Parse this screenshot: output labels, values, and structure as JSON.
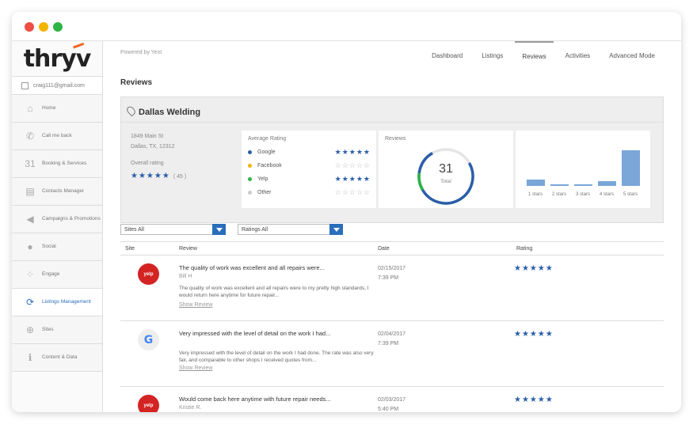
{
  "window": {
    "colors": {
      "close": "#ee4f44",
      "minimize": "#f4b400",
      "maximize": "#2fb446"
    }
  },
  "sidebar": {
    "logo": "thryv",
    "user_email": "craig111@gmail.com",
    "items": [
      {
        "label": "Home",
        "icon": "home-icon",
        "glyph": "⌂"
      },
      {
        "label": "Call me back",
        "icon": "phone-icon",
        "glyph": "✆"
      },
      {
        "label": "Booking & Services",
        "icon": "calendar-icon",
        "glyph": "31"
      },
      {
        "label": "Contacts Manager",
        "icon": "contact-card-icon",
        "glyph": "▤"
      },
      {
        "label": "Campaigns & Promotions",
        "icon": "megaphone-icon",
        "glyph": "◀"
      },
      {
        "label": "Social",
        "icon": "people-icon",
        "glyph": "●"
      },
      {
        "label": "Engage",
        "icon": "network-icon",
        "glyph": "⁘"
      },
      {
        "label": "Listings Management",
        "icon": "listings-icon",
        "glyph": "⟳"
      },
      {
        "label": "Sites",
        "icon": "globe-icon",
        "glyph": "⊕"
      },
      {
        "label": "Content & Data",
        "icon": "info-icon",
        "glyph": "ℹ"
      }
    ],
    "active_index": 7
  },
  "header": {
    "powered_by": "Powered by Yext",
    "tabs": [
      "Dashboard",
      "Listings",
      "Reviews",
      "Activities",
      "Advanced Mode"
    ],
    "active_tab": "Reviews"
  },
  "page_title": "Reviews",
  "business": {
    "name": "Dallas Welding",
    "address_line1": "1849 Main St",
    "address_line2": "Dallas, TX, 12312",
    "overall_rating_label": "Overall rating",
    "overall_stars": "★★★★★",
    "overall_count": "( 45 )"
  },
  "average_rating": {
    "title": "Average Rating",
    "sources": [
      {
        "name": "Google",
        "color": "#2a5ea8",
        "stars": "★★★★★",
        "empty": false
      },
      {
        "name": "Facebook",
        "color": "#f4b400",
        "stars": "☆☆☆☆☆",
        "empty": true
      },
      {
        "name": "Yelp",
        "color": "#2fb446",
        "stars": "★★★★★",
        "empty": false
      },
      {
        "name": "Other",
        "color": "#cccccc",
        "stars": "☆☆☆☆☆",
        "empty": true
      }
    ]
  },
  "reviews_summary": {
    "title": "Reviews",
    "total": "31",
    "total_label": "Total"
  },
  "distribution": {
    "labels": [
      "1 stars",
      "2 stars",
      "3 stars",
      "4 stars",
      "5 stars"
    ],
    "values": [
      4,
      1,
      1,
      3,
      22
    ]
  },
  "filters": {
    "sites": "Sites All",
    "ratings": "Ratings All"
  },
  "table": {
    "headers": {
      "site": "Site",
      "review": "Review",
      "date": "Date",
      "rating": "Rating"
    },
    "rows": [
      {
        "site": "yelp",
        "site_label": "yelp",
        "title": "The quality of work was excellent and all repairs were...",
        "author": "Bill H",
        "body": "The quality of work was excellent and all repairs were to my pretty high standards, I would return here anytime for future repair...",
        "show": "Show Review",
        "date": "02/15/2017",
        "time": "7:39 PM",
        "stars": "★★★★★"
      },
      {
        "site": "google",
        "site_label": "G",
        "title": "Very impressed with the level of detail on the work I had...",
        "author": "",
        "body": "Very impressed with the level of detail on the work I had done. The rate was also very fair, and comparable to other shops I received quotes from...",
        "show": "Show Review",
        "date": "02/04/2017",
        "time": "7:39 PM",
        "stars": "★★★★★"
      },
      {
        "site": "yelp",
        "site_label": "yelp",
        "title": "Would come back here anytime with future repair needs...",
        "author": "Kristie R.",
        "body": "",
        "show": "",
        "date": "02/03/2017",
        "time": "5:40 PM",
        "stars": "★★★★★"
      }
    ]
  }
}
